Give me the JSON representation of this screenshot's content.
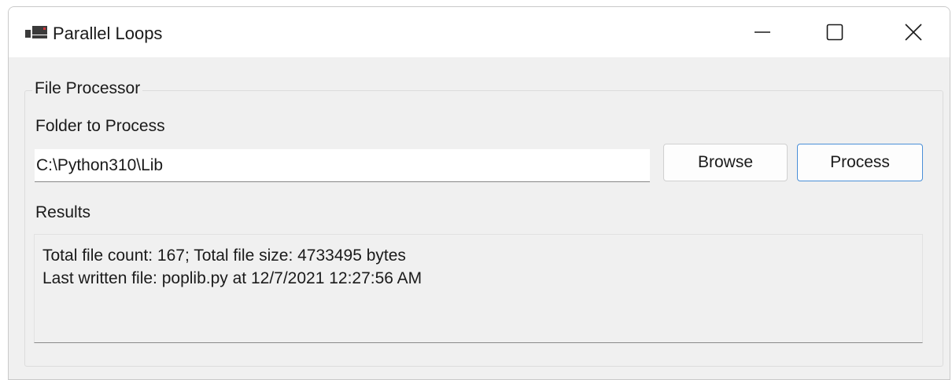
{
  "window": {
    "title": "Parallel Loops",
    "icon": "app-window-icon"
  },
  "caption_buttons": {
    "minimize_icon": "minimize-icon",
    "maximize_icon": "maximize-icon",
    "close_icon": "close-icon"
  },
  "group": {
    "title": "File Processor"
  },
  "folder": {
    "label": "Folder to Process",
    "value": "C:\\Python310\\Lib"
  },
  "buttons": {
    "browse_label": "Browse",
    "process_label": "Process"
  },
  "results": {
    "label": "Results",
    "lines": [
      "Total file count: 167; Total file size: 4733495 bytes",
      "Last written file: poplib.py at 12/7/2021 12:27:56 AM"
    ]
  },
  "colors": {
    "window_bg": "#f0f0f0",
    "titlebar_bg": "#ffffff",
    "accent_border": "#4a8fd8",
    "icon_dark": "#3b3b3b",
    "icon_red": "#d13438"
  }
}
